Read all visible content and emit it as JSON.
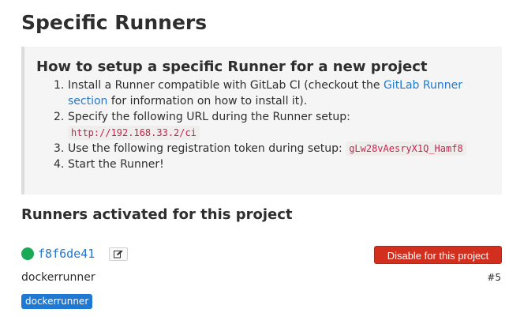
{
  "page_title": "Specific Runners",
  "setup": {
    "title": "How to setup a specific Runner for a new project",
    "steps": {
      "s1": {
        "num": "1.",
        "text_before": "Install a Runner compatible with GitLab CI (checkout the ",
        "link": "GitLab Runner section",
        "text_after": " for information on how to install it)."
      },
      "s2": {
        "num": "2.",
        "text": "Specify the following URL during the Runner setup:",
        "code": "http://192.168.33.2/ci"
      },
      "s3": {
        "num": "3.",
        "text": "Use the following registration token during setup:",
        "code": "gLw28vAesryX1Q_Hamf8"
      },
      "s4": {
        "num": "4.",
        "text": "Start the Runner!"
      }
    }
  },
  "runners_section": {
    "title": "Runners activated for this project",
    "runner": {
      "status": "active",
      "status_color": "#1aaa55",
      "token": "f8f6de41",
      "edit_icon": "edit-icon",
      "disable_label": "Disable for this project",
      "description": "dockerrunner",
      "id": "#5",
      "tags": [
        "dockerrunner"
      ]
    }
  },
  "colors": {
    "link": "#1f78d1",
    "danger": "#d22f1f",
    "code_text": "#c7254e",
    "tag_bg": "#1f78d1"
  }
}
